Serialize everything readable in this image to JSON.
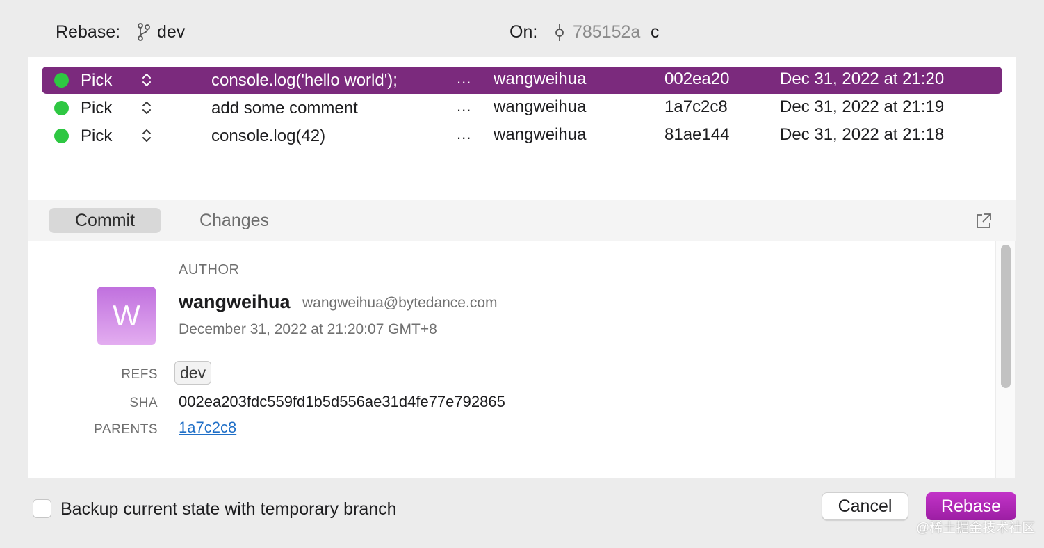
{
  "header": {
    "rebase_label": "Rebase:",
    "branch": "dev",
    "on_label": "On:",
    "on_hash": "785152a",
    "on_suffix": "c"
  },
  "commits": [
    {
      "action": "Pick",
      "message": "console.log('hello world');",
      "more": "...",
      "author": "wangweihua",
      "hash": "002ea20",
      "date": "Dec 31, 2022 at 21:20",
      "selected": true
    },
    {
      "action": "Pick",
      "message": "add some comment",
      "more": "...",
      "author": "wangweihua",
      "hash": "1a7c2c8",
      "date": "Dec 31, 2022 at 21:19",
      "selected": false
    },
    {
      "action": "Pick",
      "message": "console.log(42)",
      "more": "...",
      "author": "wangweihua",
      "hash": "81ae144",
      "date": "Dec 31, 2022 at 21:18",
      "selected": false
    }
  ],
  "tabs": {
    "commit": "Commit",
    "changes": "Changes",
    "active": "Commit"
  },
  "detail": {
    "author_heading": "AUTHOR",
    "avatar_letter": "W",
    "author_name": "wangweihua",
    "author_email": "wangweihua@bytedance.com",
    "author_date": "December 31, 2022 at 21:20:07 GMT+8",
    "refs_label": "REFS",
    "refs_value": "dev",
    "sha_label": "SHA",
    "sha_value": "002ea203fdc559fd1b5d556ae31d4fe77e792865",
    "parents_label": "PARENTS",
    "parents_value": "1a7c2c8"
  },
  "footer": {
    "backup_label": "Backup current state with temporary branch",
    "backup_checked": false,
    "cancel_label": "Cancel",
    "rebase_label": "Rebase"
  },
  "watermark": "@稀土掘金技术社区",
  "colors": {
    "selection": "#7b2a7d",
    "status_dot": "#2ec742",
    "primary_button": "#b02ab6",
    "link": "#1f6fc7"
  }
}
